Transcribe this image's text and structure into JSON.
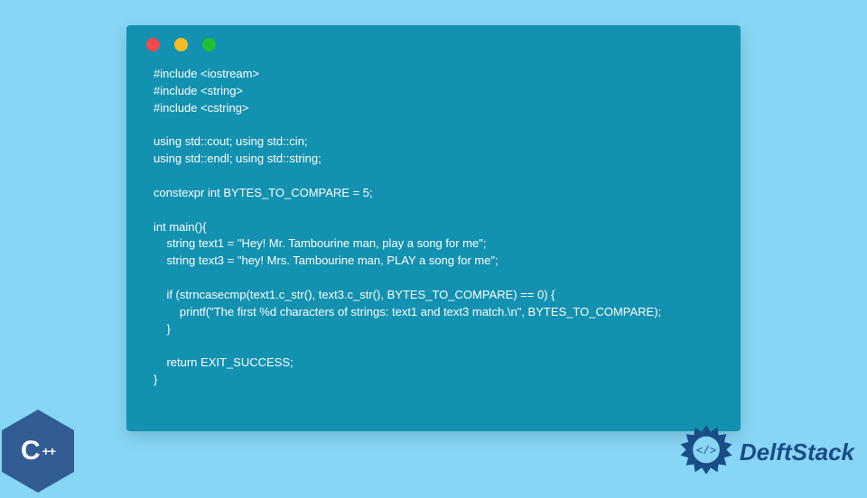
{
  "code": {
    "line1": "#include <iostream>",
    "line2": "#include <string>",
    "line3": "#include <cstring>",
    "line4": "",
    "line5": "using std::cout; using std::cin;",
    "line6": "using std::endl; using std::string;",
    "line7": "",
    "line8": "constexpr int BYTES_TO_COMPARE = 5;",
    "line9": "",
    "line10": "int main(){",
    "line11": "    string text1 = \"Hey! Mr. Tambourine man, play a song for me\";",
    "line12": "    string text3 = \"hey! Mrs. Tambourine man, PLAY a song for me\";",
    "line13": "",
    "line14": "    if (strncasecmp(text1.c_str(), text3.c_str(), BYTES_TO_COMPARE) == 0) {",
    "line15": "        printf(\"The first %d characters of strings: text1 and text3 match.\\n\", BYTES_TO_COMPARE);",
    "line16": "    }",
    "line17": "",
    "line18": "    return EXIT_SUCCESS;",
    "line19": "}"
  },
  "logos": {
    "cpp_letter": "C",
    "cpp_plus": "++",
    "delft_text": "DelftStack"
  },
  "colors": {
    "page_bg": "#87d6f5",
    "window_bg": "#1391b1",
    "traffic_red": "#f2494e",
    "traffic_yellow": "#f8bd23",
    "traffic_green": "#20c035",
    "cpp_hex": "#315c94",
    "delft_text": "#1a4c88"
  }
}
